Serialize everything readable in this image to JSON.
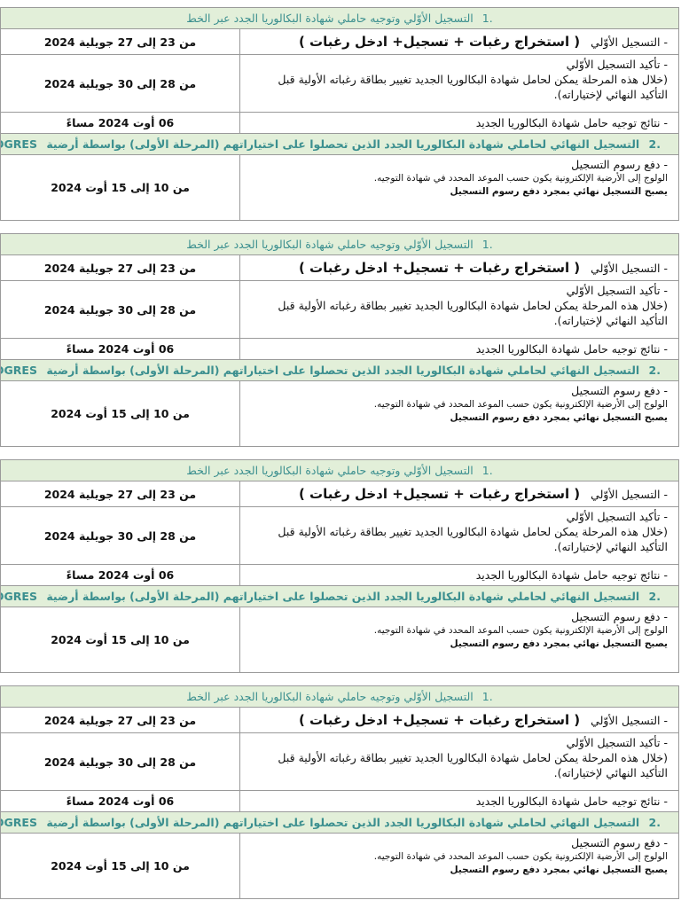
{
  "blocks": [
    {
      "section1_num": ".1",
      "section1_title": "التسجيل الأوّلي وتوجيه حاملي شهادة البكالوريا الجدد عبر الخط",
      "row1_label": "- التسجيل الأوّلي",
      "row1_emphasis": "( استخراج رغبات + تسجيل+ ادخل رغبات )",
      "row1_date": "من 23 إلى 27 جويلية 2024",
      "row2_line1": "- تأكيد التسجيل الأوّلي",
      "row2_line2": "(خلال هذه المرحلة يمكن لحامل شهادة البكالوريا الجديد تغيير بطاقة رغباته الأولية قبل التأكيد النهائي لإختياراته).",
      "row2_date": "من 28 إلى 30 جويلية 2024",
      "row3_text": "- نتائج توجيه حامل شهادة البكالوريا الجديد",
      "row3_date": "06 أوت 2024 مساءً",
      "section2_num": ".2",
      "section2_title": "التسجيل النهائي لحاملي شهادة البكالوريا الجدد الذين تحصلوا على اختياراتهم (المرحلة الأولى) بواسطة أرضية",
      "section2_platform": "PROGRES",
      "row4_line1": "- دفع رسوم التسجيل",
      "row4_line2": "الولوج إلى الأرضية الإلكترونية يكون حسب الموعد المحدد في شهادة التوجيه.",
      "row4_line3": "يصبح التسجيل نهائي بمجرد دفع رسوم التسجيل",
      "row4_date": "من 10 إلى 15 أوت 2024"
    },
    {
      "section1_num": ".1",
      "section1_title": "التسجيل الأوّلي وتوجيه حاملي شهادة البكالوريا الجدد عبر الخط",
      "row1_label": "- التسجيل الأوّلي",
      "row1_emphasis": "( استخراج رغبات + تسجيل+ ادخل رغبات )",
      "row1_date": "من 23 إلى 27 جويلية 2024",
      "row2_line1": "- تأكيد التسجيل الأوّلي",
      "row2_line2": "(خلال هذه المرحلة يمكن لحامل شهادة البكالوريا الجديد تغيير بطاقة رغباته الأولية قبل التأكيد النهائي لإختياراته).",
      "row2_date": "من 28 إلى 30 جويلية 2024",
      "row3_text": "- نتائج توجيه حامل شهادة البكالوريا الجديد",
      "row3_date": "06 أوت 2024 مساءً",
      "section2_num": ".2",
      "section2_title": "التسجيل النهائي لحاملي شهادة البكالوريا الجدد الذين تحصلوا على اختياراتهم (المرحلة الأولى) بواسطة أرضية",
      "section2_platform": "PROGRES",
      "row4_line1": "- دفع رسوم التسجيل",
      "row4_line2": "الولوج إلى الأرضية الإلكترونية يكون حسب الموعد المحدد في شهادة التوجيه.",
      "row4_line3": "يصبح التسجيل نهائي بمجرد دفع رسوم التسجيل",
      "row4_date": "من 10 إلى 15 أوت 2024"
    },
    {
      "section1_num": ".1",
      "section1_title": "التسجيل الأوّلي وتوجيه حاملي شهادة البكالوريا الجدد عبر الخط",
      "row1_label": "- التسجيل الأوّلي",
      "row1_emphasis": "( استخراج رغبات + تسجيل+ ادخل رغبات )",
      "row1_date": "من 23 إلى 27 جويلية 2024",
      "row2_line1": "- تأكيد التسجيل الأوّلي",
      "row2_line2": "(خلال هذه المرحلة يمكن لحامل شهادة البكالوريا الجديد تغيير بطاقة رغباته الأولية قبل التأكيد النهائي لإختياراته).",
      "row2_date": "من 28 إلى 30 جويلية 2024",
      "row3_text": "- نتائج توجيه حامل شهادة البكالوريا الجديد",
      "row3_date": "06 أوت 2024 مساءً",
      "section2_num": ".2",
      "section2_title": "التسجيل النهائي لحاملي شهادة البكالوريا الجدد الذين تحصلوا على اختياراتهم (المرحلة الأولى) بواسطة أرضية",
      "section2_platform": "PROGRES",
      "row4_line1": "- دفع رسوم التسجيل",
      "row4_line2": "الولوج إلى الأرضية الإلكترونية يكون حسب الموعد المحدد في شهادة التوجيه.",
      "row4_line3": "يصبح التسجيل نهائي بمجرد دفع رسوم التسجيل",
      "row4_date": "من 10 إلى 15 أوت 2024"
    },
    {
      "section1_num": ".1",
      "section1_title": "التسجيل الأوّلي وتوجيه حاملي شهادة البكالوريا الجدد عبر الخط",
      "row1_label": "- التسجيل الأوّلي",
      "row1_emphasis": "( استخراج رغبات + تسجيل+ ادخل رغبات )",
      "row1_date": "من 23 إلى 27 جويلية 2024",
      "row2_line1": "- تأكيد التسجيل الأوّلي",
      "row2_line2": "(خلال هذه المرحلة يمكن لحامل شهادة البكالوريا الجديد تغيير بطاقة رغباته الأولية قبل التأكيد النهائي لإختياراته).",
      "row2_date": "من 28 إلى 30 جويلية 2024",
      "row3_text": "- نتائج توجيه حامل شهادة البكالوريا الجديد",
      "row3_date": "06 أوت 2024 مساءً",
      "section2_num": ".2",
      "section2_title": "التسجيل النهائي لحاملي شهادة البكالوريا الجدد الذين تحصلوا على اختياراتهم (المرحلة الأولى) بواسطة أرضية",
      "section2_platform": "PROGRES",
      "row4_line1": "- دفع رسوم التسجيل",
      "row4_line2": "الولوج إلى الأرضية الإلكترونية يكون حسب الموعد المحدد في شهادة التوجيه.",
      "row4_line3": "يصبح التسجيل نهائي بمجرد دفع رسوم التسجيل",
      "row4_date": "من 10 إلى 15 أوت 2024"
    }
  ],
  "colors": {
    "header_bg": "#e2efd9",
    "header_text": "#3b8f8f",
    "border": "#9a9a9a"
  }
}
